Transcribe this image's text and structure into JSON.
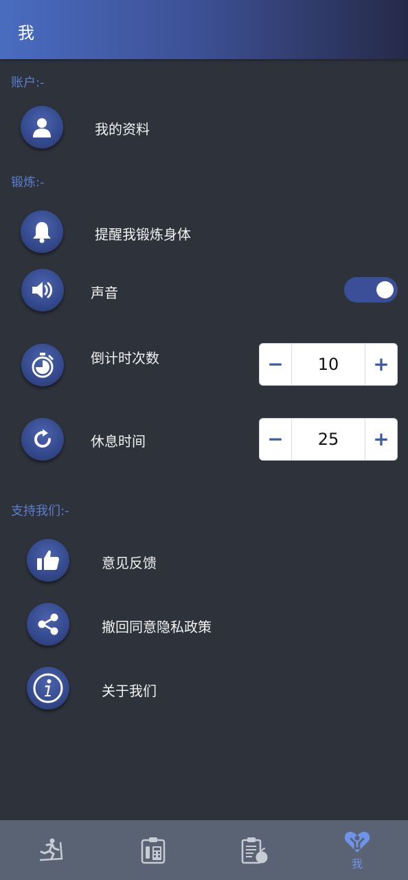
{
  "header": {
    "title": "我"
  },
  "sections": {
    "account": "账户:-",
    "exercise": "锻炼:-",
    "support": "支持我们:-"
  },
  "account": {
    "profile_label": "我的资料"
  },
  "exercise": {
    "reminder_label": "提醒我锻炼身体",
    "sound_label": "声音",
    "sound_enabled": true,
    "countdown_label": "倒计时次数",
    "countdown_value": "10",
    "rest_label": "休息时间",
    "rest_value": "25"
  },
  "support": {
    "feedback_label": "意见反馈",
    "withdraw_consent_label": "撤回同意隐私政策",
    "about_label": "关于我们"
  },
  "bottom_nav": {
    "items": [
      {
        "icon": "treadmill-icon",
        "label": ""
      },
      {
        "icon": "clipboard-calculator-icon",
        "label": ""
      },
      {
        "icon": "diet-plan-icon",
        "label": ""
      },
      {
        "icon": "heart-person-icon",
        "label": "我",
        "active": true
      }
    ]
  },
  "colors": {
    "background": "#2e333b",
    "accent": "#5b7ed0",
    "icon_circle": "#34498c",
    "nav_bar": "#5a6374",
    "active_nav": "#6f93e8"
  }
}
